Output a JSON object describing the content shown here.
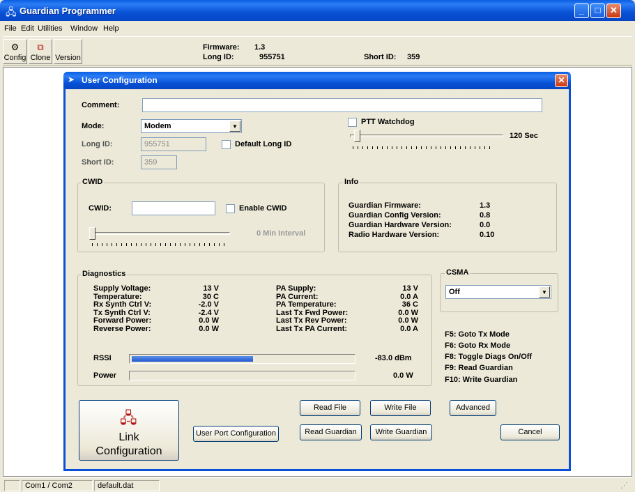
{
  "app": {
    "title": "Guardian Programmer",
    "menu": [
      "File",
      "Edit",
      "Utilities",
      "Window",
      "Help"
    ]
  },
  "toolbar": {
    "buttons": [
      "Config",
      "Clone",
      "Version"
    ],
    "firmware_label": "Firmware:",
    "firmware_value": "1.3",
    "long_id_label": "Long ID:",
    "long_id_value": "955751",
    "short_id_label": "Short ID:",
    "short_id_value": "359"
  },
  "status": {
    "ports": "Com1 / Com2",
    "file": "default.dat"
  },
  "dialog": {
    "title": "User Configuration",
    "comment_label": "Comment:",
    "comment_value": "",
    "mode_label": "Mode:",
    "mode_value": "Modem",
    "long_id_label": "Long ID:",
    "long_id_value": "955751",
    "default_long_id_label": "Default Long ID",
    "short_id_label": "Short ID:",
    "short_id_value": "359",
    "ptt_watchdog_label": "PTT Watchdog",
    "ptt_watchdog_value": "120 Sec",
    "cwid": {
      "group_title": "CWID",
      "label": "CWID:",
      "value": "",
      "enable_label": "Enable CWID",
      "interval_value": "0 Min Interval"
    },
    "info": {
      "group_title": "Info",
      "rows": [
        {
          "label": "Guardian Firmware:",
          "value": "1.3"
        },
        {
          "label": "Guardian Config Version:",
          "value": "0.8"
        },
        {
          "label": "Guardian Hardware Version:",
          "value": "0.0"
        },
        {
          "label": "Radio Hardware Version:",
          "value": "0.10"
        }
      ]
    },
    "diagnostics": {
      "group_title": "Diagnostics",
      "left": [
        {
          "label": "Supply Voltage:",
          "value": "13 V"
        },
        {
          "label": "Temperature:",
          "value": "30 C"
        },
        {
          "label": "Rx Synth Ctrl V:",
          "value": "-2.0 V"
        },
        {
          "label": "Tx Synth Ctrl V:",
          "value": "-2.4 V"
        },
        {
          "label": "Forward Power:",
          "value": "0.0 W"
        },
        {
          "label": "Reverse Power:",
          "value": "0.0 W"
        }
      ],
      "right": [
        {
          "label": "PA Supply:",
          "value": "13 V"
        },
        {
          "label": "PA Current:",
          "value": "0.0 A"
        },
        {
          "label": "PA Temperature:",
          "value": "36 C"
        },
        {
          "label": "Last Tx Fwd Power:",
          "value": "0.0 W"
        },
        {
          "label": "Last Tx Rev Power:",
          "value": "0.0 W"
        },
        {
          "label": "Last Tx PA Current:",
          "value": "0.0 A"
        }
      ],
      "rssi_label": "RSSI",
      "rssi_value": "-83.0 dBm",
      "rssi_fill_fraction": 0.55,
      "power_label": "Power",
      "power_value": "0.0 W",
      "power_fill_fraction": 0.0
    },
    "csma": {
      "group_title": "CSMA",
      "value": "Off"
    },
    "hotkeys": [
      "F5: Goto Tx Mode",
      "F6: Goto Rx Mode",
      "F8: Toggle Diags On/Off",
      "F9: Read Guardian",
      "F10: Write Guardian"
    ],
    "buttons": {
      "link_config_line1": "Link",
      "link_config_line2": "Configuration",
      "user_port": "User Port Configuration",
      "read_file": "Read File",
      "write_file": "Write File",
      "advanced": "Advanced",
      "read_guardian": "Read Guardian",
      "write_guardian": "Write Guardian",
      "cancel": "Cancel"
    }
  }
}
